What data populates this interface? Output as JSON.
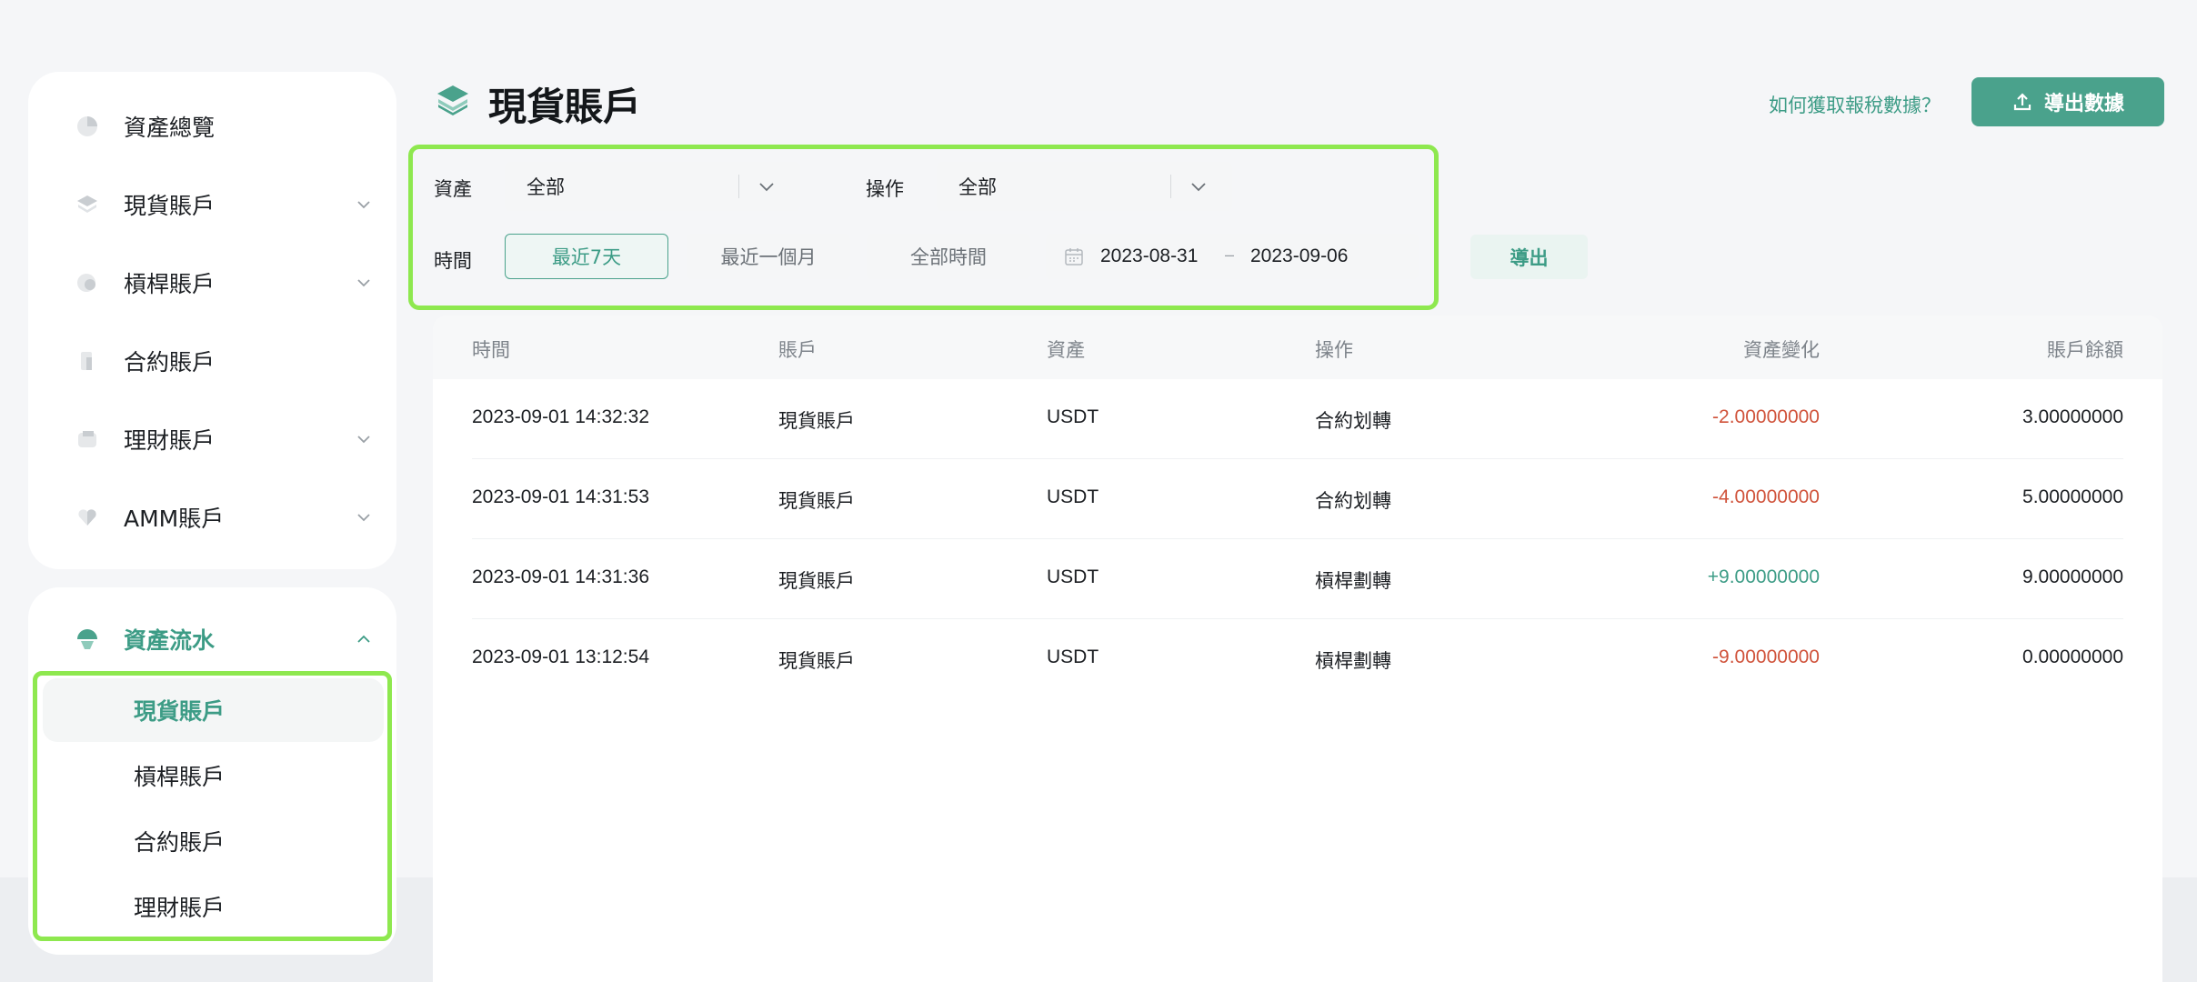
{
  "sidebar": {
    "items": [
      {
        "label": "資產總覽",
        "icon": "pie-chart-icon"
      },
      {
        "label": "現貨賬戶",
        "icon": "layers-icon"
      },
      {
        "label": "槓桿賬戶",
        "icon": "coins-icon"
      },
      {
        "label": "合約賬戶",
        "icon": "contract-icon"
      },
      {
        "label": "理財賬戶",
        "icon": "wallet-icon"
      },
      {
        "label": "AMM賬戶",
        "icon": "heart-icon"
      }
    ],
    "flow": {
      "label": "資產流水",
      "icon": "flow-icon",
      "subitems": [
        "現貨賬戶",
        "槓桿賬戶",
        "合約賬戶",
        "理財賬戶"
      ],
      "active": "現貨賬戶"
    }
  },
  "header": {
    "title": "現貨賬戶",
    "help_link": "如何獲取報稅數據？",
    "export_data_label": "導出數據"
  },
  "filters": {
    "asset_label": "資產",
    "asset_value": "全部",
    "operation_label": "操作",
    "operation_value": "全部",
    "time_label": "時間",
    "chips": [
      "最近7天",
      "最近一個月",
      "全部時間"
    ],
    "active_chip": "最近7天",
    "date_from": "2023-08-31",
    "date_separator": "–",
    "date_to": "2023-09-06",
    "export_label": "導出"
  },
  "table": {
    "headers": [
      "時間",
      "賬戶",
      "資產",
      "操作",
      "資產變化",
      "賬戶餘額"
    ],
    "rows": [
      {
        "time": "2023-09-01 14:32:32",
        "account": "現貨賬戶",
        "asset": "USDT",
        "operation": "合約划轉",
        "change": "-2.00000000",
        "balance": "3.00000000"
      },
      {
        "time": "2023-09-01 14:31:53",
        "account": "現貨賬戶",
        "asset": "USDT",
        "operation": "合約划轉",
        "change": "-4.00000000",
        "balance": "5.00000000"
      },
      {
        "time": "2023-09-01 14:31:36",
        "account": "現貨賬戶",
        "asset": "USDT",
        "operation": "槓桿劃轉",
        "change": "+9.00000000",
        "balance": "9.00000000"
      },
      {
        "time": "2023-09-01 13:12:54",
        "account": "現貨賬戶",
        "asset": "USDT",
        "operation": "槓桿劃轉",
        "change": "-9.00000000",
        "balance": "0.00000000"
      }
    ]
  },
  "colors": {
    "accent": "#3d9c86",
    "negative": "#d0533b",
    "positive": "#3d9c86",
    "highlight": "#8ee84f"
  }
}
